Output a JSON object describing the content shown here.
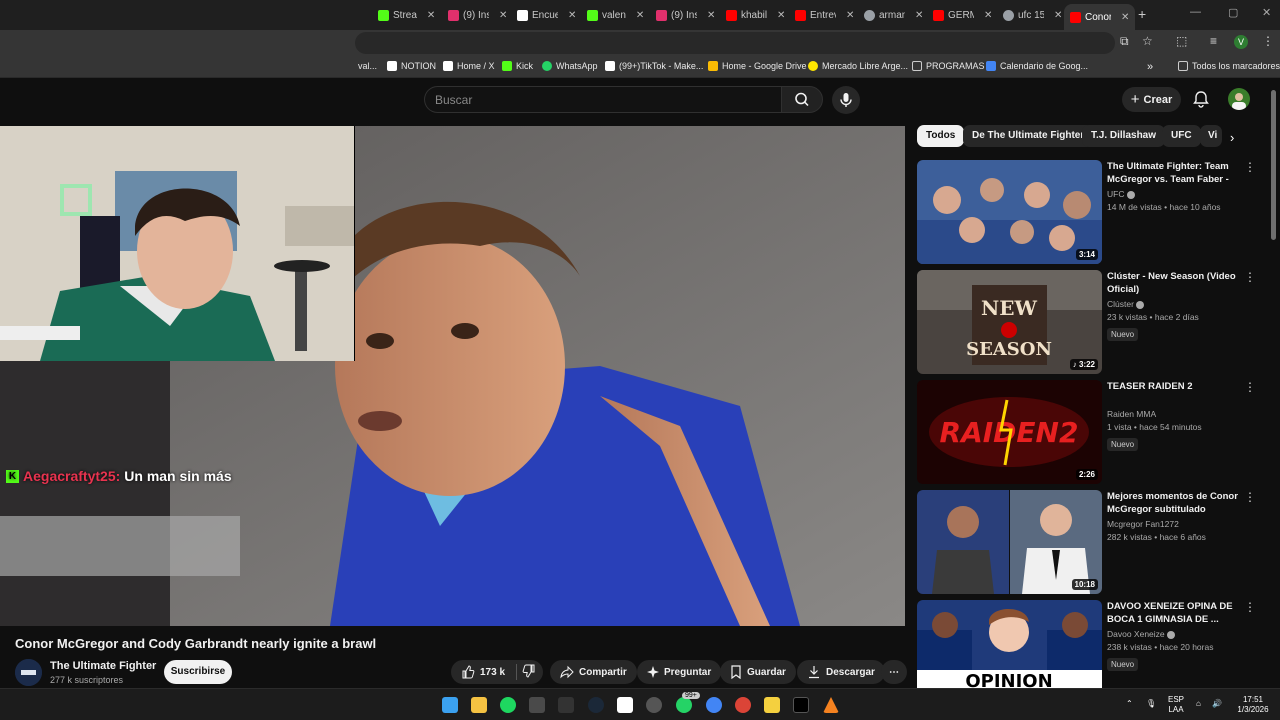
{
  "browser": {
    "tabs": [
      {
        "label": "Strea",
        "color": "#53fc18"
      },
      {
        "label": "(9) Ins",
        "color": "#e1306c"
      },
      {
        "label": "Encue",
        "color": "#ffffff"
      },
      {
        "label": "valen",
        "color": "#53fc18"
      },
      {
        "label": "(9) Ins",
        "color": "#e1306c"
      },
      {
        "label": "khabil",
        "color": "#ff0000"
      },
      {
        "label": "Entrev",
        "color": "#ff0000"
      },
      {
        "label": "arman",
        "color": "#9aa0a6"
      },
      {
        "label": "GERM",
        "color": "#ff0000"
      },
      {
        "label": "ufc 15",
        "color": "#9aa0a6"
      },
      {
        "label": "Conor",
        "color": "#ff0000"
      }
    ],
    "new_tab": "+",
    "profile_letter": "V",
    "bookmarks": [
      {
        "label": "val...",
        "color": "#9aa0a6"
      },
      {
        "label": "NOTION",
        "color": "#ffffff"
      },
      {
        "label": "Home / X",
        "color": "#ffffff"
      },
      {
        "label": "Kick",
        "color": "#53fc18"
      },
      {
        "label": "WhatsApp",
        "color": "#25d366"
      },
      {
        "label": "(99+)TikTok - Make...",
        "color": "#ffffff"
      },
      {
        "label": "Home - Google Drive",
        "color": "#fbbc04"
      },
      {
        "label": "Mercado Libre Arge...",
        "color": "#ffe600"
      },
      {
        "label": "PROGRAMAS",
        "color": "#9aa0a6"
      },
      {
        "label": "Calendario de Goog...",
        "color": "#4285f4"
      }
    ],
    "bookmarks_more": "»",
    "all_bookmarks": "Todos los marcadores"
  },
  "youtube": {
    "search_placeholder": "Buscar",
    "create_label": "Crear",
    "chat": {
      "user": "Aegacraftyt25:",
      "message": "Un man sin más"
    },
    "video_title": "Conor McGregor and Cody Garbrandt nearly ignite a brawl",
    "channel_name": "The Ultimate Fighter",
    "channel_subs": "277 k suscriptores",
    "subscribe": "Suscribirse",
    "likes": "173 k",
    "share": "Compartir",
    "ask": "Preguntar",
    "save": "Guardar",
    "download": "Descargar",
    "more": "⋯",
    "chips": [
      "Todos",
      "De The Ultimate Fighter",
      "T.J. Dillashaw",
      "UFC",
      "Vi"
    ],
    "recommendations": [
      {
        "title": "The Ultimate Fighter: Team McGregor vs. Team Faber - T...",
        "channel": "UFC",
        "meta": "14 M de vistas • hace 10 años",
        "badge": "",
        "duration": "3:14",
        "thumb": "#3d5f9a"
      },
      {
        "title": "Clúster - New Season (Video Oficial)",
        "channel": "Clúster",
        "meta": "23 k vistas • hace 2 días",
        "badge": "Nuevo",
        "duration": "♪ 3:22",
        "thumb": "#5a5048"
      },
      {
        "title": "TEASER RAIDEN 2",
        "channel": "Raiden MMA",
        "meta": "1 vista • hace 54 minutos",
        "badge": "Nuevo",
        "duration": "2:26",
        "thumb": "#2a0505"
      },
      {
        "title": "Mejores momentos de Conor McGregor subtitulado",
        "channel": "Mcgregor Fan1272",
        "meta": "282 k vistas • hace 6 años",
        "badge": "",
        "duration": "10:18",
        "thumb": "#2a3f7a"
      },
      {
        "title": "DAVOO XENEIZE OPINA DE BOCA 1 GIMNASIA DE ...",
        "channel": "Davoo Xeneize",
        "meta": "238 k vistas • hace 20 horas",
        "badge": "Nuevo",
        "duration": "",
        "thumb": "#1f3a7a"
      }
    ]
  },
  "taskbar": {
    "lang": "ESP",
    "layout": "LAA",
    "time": "17:51",
    "date": "1/3/2026",
    "badge": "99+"
  }
}
